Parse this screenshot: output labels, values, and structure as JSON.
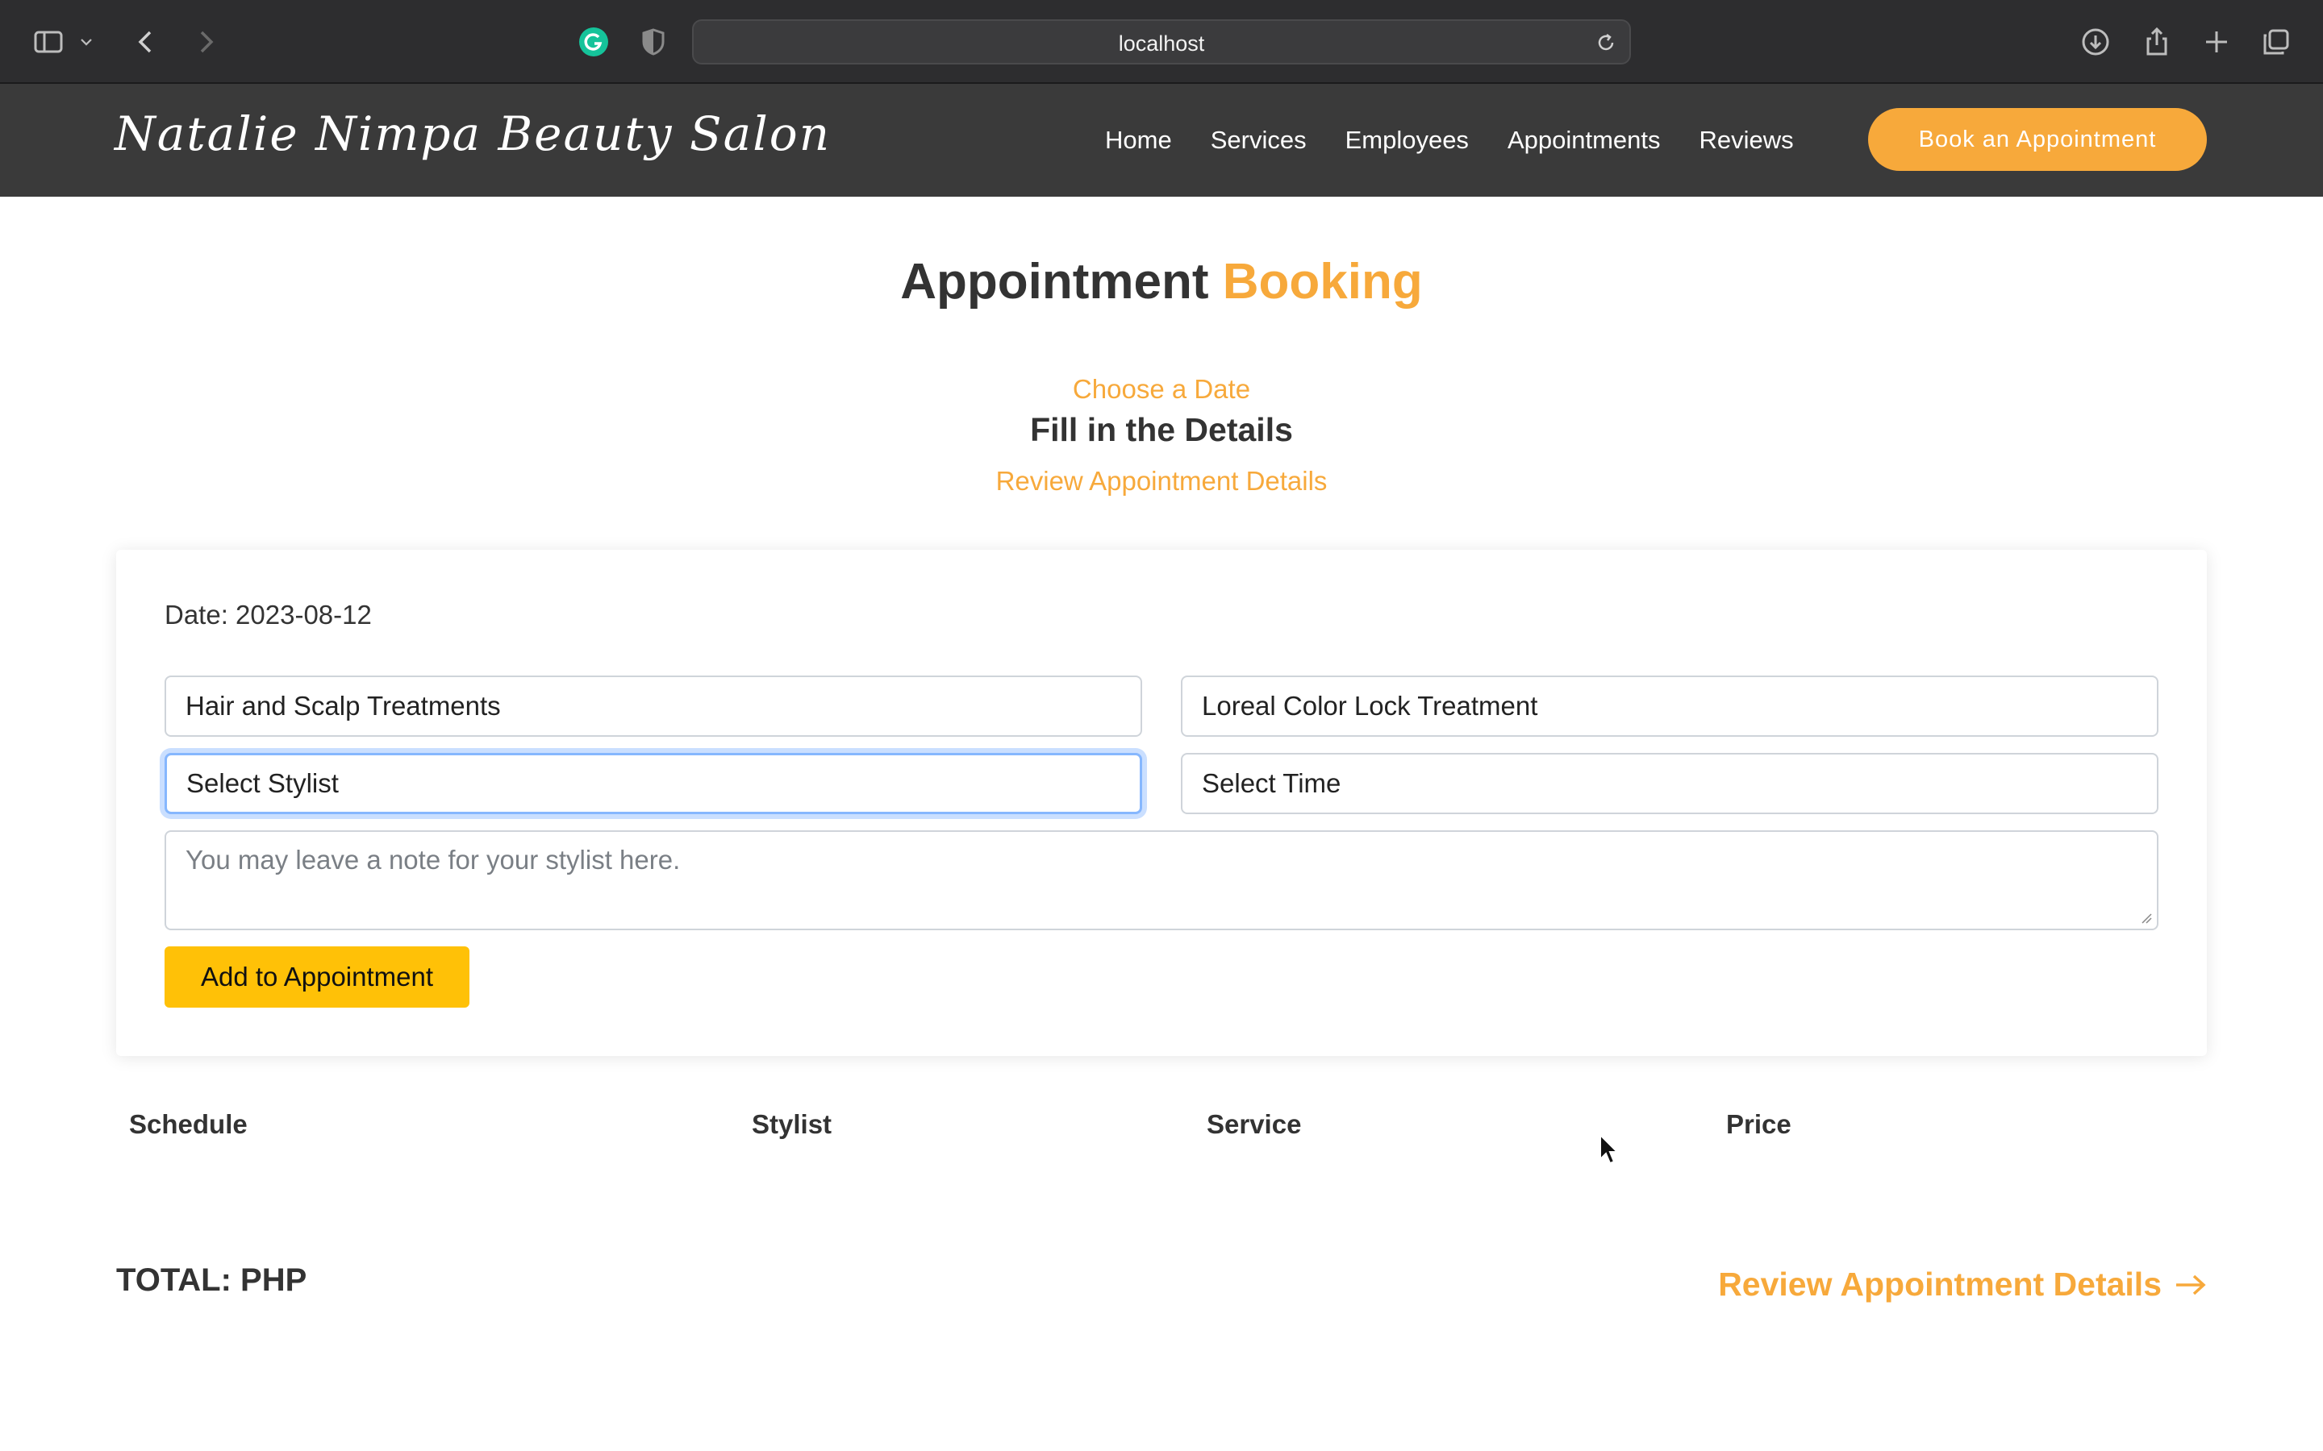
{
  "browser": {
    "url": "localhost"
  },
  "nav": {
    "brand": "Natalie Nimpa Beauty Salon",
    "links": [
      "Home",
      "Services",
      "Employees",
      "Appointments",
      "Reviews"
    ],
    "cta": "Book an Appointment"
  },
  "page": {
    "title_main": "Appointment",
    "title_accent": "Booking",
    "steps": [
      "Choose a Date",
      "Fill in the Details",
      "Review Appointment Details"
    ]
  },
  "form": {
    "date_label": "Date: 2023-08-12",
    "category": "Hair and Scalp Treatments",
    "service": "Loreal Color Lock Treatment",
    "stylist": "Select Stylist",
    "time": "Select Time",
    "note_placeholder": "You may leave a note for your stylist here.",
    "add_button": "Add to Appointment"
  },
  "table": {
    "headers": [
      "Schedule",
      "Stylist",
      "Service",
      "Price"
    ]
  },
  "summary": {
    "total": "TOTAL: PHP",
    "review_link": "Review Appointment Details"
  },
  "colors": {
    "accent": "#f7a93b",
    "nav_bg": "#3a3a3a",
    "button_yellow": "#ffc107"
  }
}
